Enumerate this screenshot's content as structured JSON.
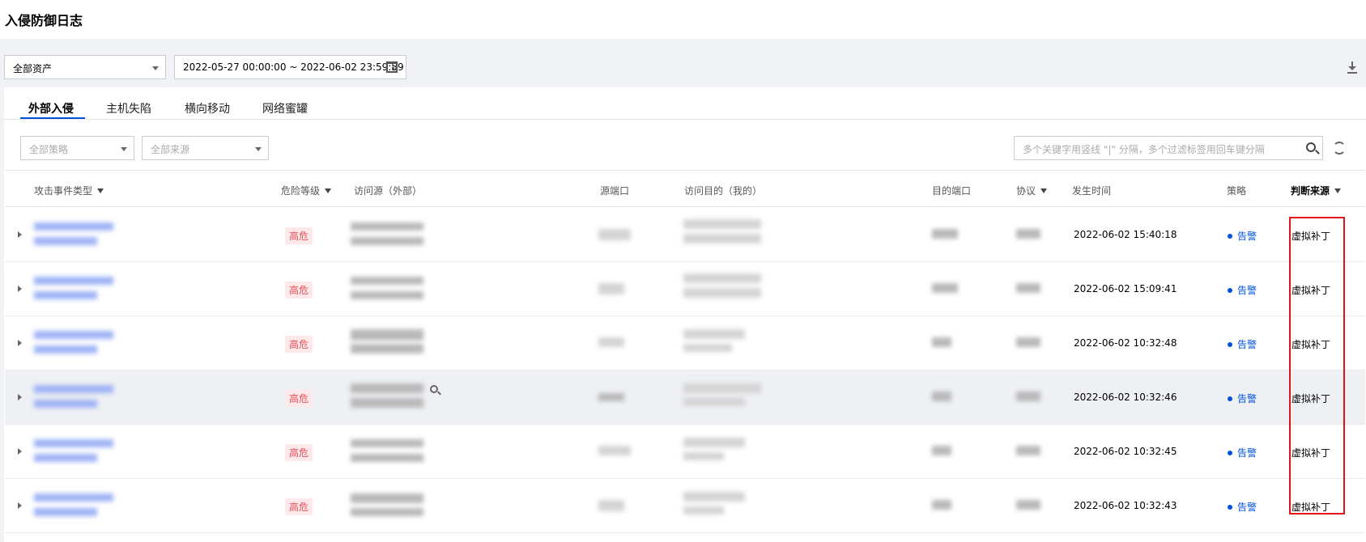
{
  "page": {
    "title": "入侵防御日志"
  },
  "toolbar": {
    "asset_select": "全部资产",
    "date_range": "2022-05-27 00:00:00 ~ 2022-06-02 23:59:59"
  },
  "tabs": [
    {
      "label": "外部入侵",
      "active": true
    },
    {
      "label": "主机失陷",
      "active": false
    },
    {
      "label": "横向移动",
      "active": false
    },
    {
      "label": "网络蜜罐",
      "active": false
    }
  ],
  "filters": {
    "policy_placeholder": "全部策略",
    "source_placeholder": "全部来源",
    "search_placeholder": "多个关键字用竖线 \"|\" 分隔，多个过滤标签用回车键分隔"
  },
  "table": {
    "columns": [
      "攻击事件类型",
      "危险等级",
      "访问源（外部）",
      "源端口",
      "访问目的（我的）",
      "目的端口",
      "协议",
      "发生时间",
      "策略",
      "判断来源"
    ],
    "rows": [
      {
        "risk": "高危",
        "time": "2022-06-02 15:40:18",
        "policy": "告警",
        "source": "虚拟补丁"
      },
      {
        "risk": "高危",
        "time": "2022-06-02 15:09:41",
        "policy": "告警",
        "source": "虚拟补丁"
      },
      {
        "risk": "高危",
        "time": "2022-06-02 10:32:48",
        "policy": "告警",
        "source": "虚拟补丁"
      },
      {
        "risk": "高危",
        "time": "2022-06-02 10:32:46",
        "policy": "告警",
        "source": "虚拟补丁"
      },
      {
        "risk": "高危",
        "time": "2022-06-02 10:32:45",
        "policy": "告警",
        "source": "虚拟补丁"
      },
      {
        "risk": "高危",
        "time": "2022-06-02 10:32:43",
        "policy": "告警",
        "source": "虚拟补丁"
      }
    ]
  },
  "icons": {
    "filter": "filter-icon",
    "calendar": "calendar-icon",
    "download": "download-icon",
    "search": "search-icon",
    "refresh": "refresh-icon",
    "expand": "expand-arrow-icon"
  },
  "colors": {
    "accent": "#0052d9",
    "risk_high": "#e34d59",
    "highlight_box": "#e0121b"
  }
}
